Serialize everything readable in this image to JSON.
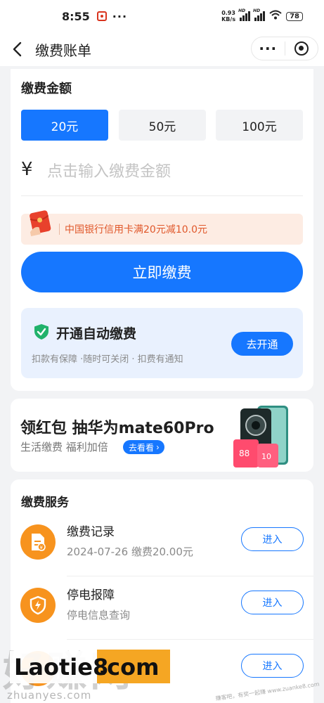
{
  "status_bar": {
    "time": "8:55",
    "dots": "···",
    "net_speed_value": "0.93",
    "net_speed_unit": "KB/s",
    "hd1": "HD",
    "hd2": "HD",
    "battery": "78"
  },
  "nav": {
    "title": "缴费账单",
    "more": "···"
  },
  "amount_card": {
    "title": "缴费金额",
    "options": [
      "20元",
      "50元",
      "100元"
    ],
    "selected_index": 0,
    "currency": "¥",
    "input_placeholder": "点击输入缴费金额",
    "promo_text": "中国银行信用卡满20元减10.0元",
    "pay_button": "立即缴费",
    "auto_pay_title": "开通自动缴费",
    "auto_pay_sub": "扣款有保障 ·随时可关闭 · 扣费有通知",
    "auto_pay_button": "去开通"
  },
  "banner": {
    "title": "领红包 抽华为mate60Pro",
    "subtitle": "生活缴费 福利加倍",
    "tag": "去看看",
    "img_text_1": "88",
    "img_text_2": "10"
  },
  "services": {
    "title": "缴费服务",
    "items": [
      {
        "name": "缴费记录",
        "desc": "2024-07-26 缴费20.00元",
        "button": "进入",
        "icon": "bill-record-icon"
      },
      {
        "name": "停电报障",
        "desc": "停电信息查询",
        "button": "进入",
        "icon": "power-shield-icon"
      },
      {
        "name": "",
        "desc": "",
        "button": "进入",
        "icon": "service-icon"
      }
    ]
  },
  "watermark": {
    "brand_big": "好赚网",
    "laotie": "Laotie8",
    "com": ".com",
    "site": "zhuanyes.com",
    "small": "赚客吧，有奖一起赚 www.zuanke8.com"
  },
  "colors": {
    "accent": "#1677ff",
    "orange": "#f7931e",
    "promo_bg": "#fdece3",
    "promo_text": "#e0572a"
  }
}
